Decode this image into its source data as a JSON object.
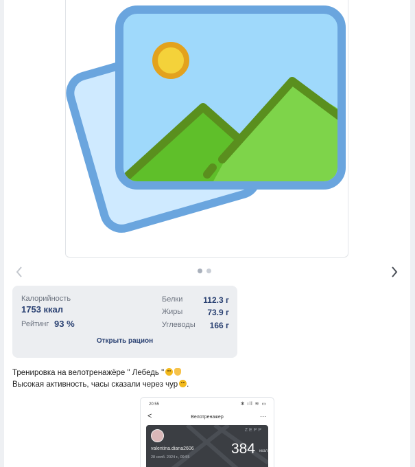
{
  "carousel": {
    "image_icon": "image-placeholder-icon",
    "prev_icon": "chevron-left-icon",
    "next_icon": "chevron-right-icon",
    "dots_total": 2,
    "dots_active": 1
  },
  "nutrition": {
    "calories_label": "Калорийность",
    "calories_value": "1753 ккал",
    "rating_label": "Рейтинг",
    "rating_value": "93 %",
    "macros": [
      {
        "label": "Белки",
        "value": "112.3 г"
      },
      {
        "label": "Жиры",
        "value": "73.9 г"
      },
      {
        "label": "Углеводы",
        "value": "166 г"
      }
    ],
    "open_label": "Открыть рацион"
  },
  "post": {
    "line1": "Тренировка на велотренажёре \" Лебедь \"",
    "line2": "Высокая активность, часы сказали через чур"
  },
  "phone_screenshot": {
    "status_time": "20:55",
    "status_icons": "✻ ıll ≋ ▭",
    "back": "<",
    "title": "Велотренажер",
    "menu": "···",
    "brand": "ZEPP",
    "user": "valentina.diana2606",
    "date": "28 нояб. 2024 г., 09:55",
    "kcal_value": "384",
    "kcal_unit": "ккал"
  },
  "colors": {
    "accent_text": "#2a4172",
    "panel_bg": "#eceef1"
  }
}
